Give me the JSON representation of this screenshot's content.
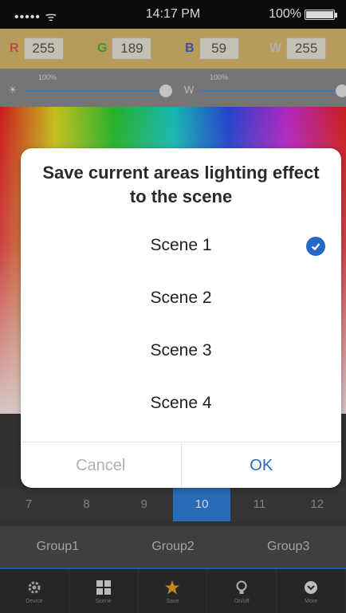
{
  "status": {
    "signal": "••••• ᯤ",
    "time": "14:17 PM",
    "battery": "100%"
  },
  "channels": [
    {
      "label": "R",
      "value": "255",
      "color": "#e05a5a"
    },
    {
      "label": "G",
      "value": "189",
      "color": "#3fb04f"
    },
    {
      "label": "B",
      "value": "59",
      "color": "#3f63c8"
    },
    {
      "label": "W",
      "value": "255",
      "color": "#cfcfcf"
    }
  ],
  "sliders": [
    {
      "percent": "100%",
      "symbol": "☀"
    },
    {
      "percent": "100%",
      "symbol": "W"
    }
  ],
  "dialog": {
    "title": "Save current areas lighting effect to the scene",
    "scenes": [
      "Scene 1",
      "Scene 2",
      "Scene 3",
      "Scene 4"
    ],
    "selected": "Scene 1",
    "cancel": "Cancel",
    "ok": "OK"
  },
  "numbers": [
    "7",
    "8",
    "9",
    "10",
    "11",
    "12"
  ],
  "selected_number": "10",
  "groups": [
    "Group1",
    "Group2",
    "Group3"
  ],
  "tabs": [
    {
      "label": "Device",
      "icon": "gear-icon"
    },
    {
      "label": "Scene",
      "icon": "grid-icon"
    },
    {
      "label": "Save",
      "icon": "star-icon"
    },
    {
      "label": "On/off",
      "icon": "bulb-icon"
    },
    {
      "label": "More",
      "icon": "chevron-icon"
    }
  ],
  "colors": {
    "accent": "#2767c8",
    "selected_number": "#2f7ed8",
    "header": "#d7b76b"
  }
}
